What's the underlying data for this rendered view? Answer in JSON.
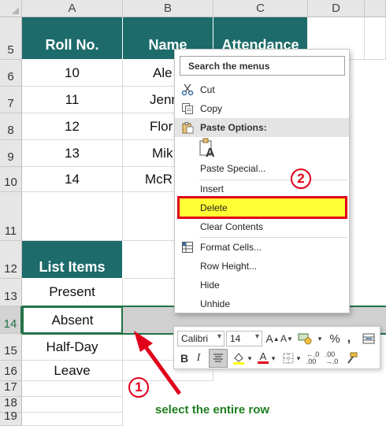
{
  "columns": [
    "A",
    "B",
    "C",
    "D"
  ],
  "rows": [
    "5",
    "6",
    "7",
    "8",
    "9",
    "10",
    "11",
    "12",
    "13",
    "14",
    "15",
    "16",
    "17",
    "18",
    "19"
  ],
  "table": {
    "headers": [
      "Roll No.",
      "Name",
      "Attendance"
    ],
    "roll_numbers": [
      "10",
      "11",
      "12",
      "13",
      "14"
    ],
    "names_visible": [
      "Ale",
      "Jenn",
      "Flor",
      "Mik",
      "McR"
    ]
  },
  "list": {
    "header": "List Items",
    "items": [
      "Present",
      "Absent",
      "Half-Day",
      "Leave"
    ]
  },
  "context_menu": {
    "search_placeholder": "Search the menus",
    "items": {
      "cut": "Cut",
      "copy": "Copy",
      "paste_options": "Paste Options:",
      "paste_special": "Paste Special...",
      "insert": "Insert",
      "delete": "Delete",
      "clear_contents": "Clear Contents",
      "format_cells": "Format Cells...",
      "row_height": "Row Height...",
      "hide": "Hide",
      "unhide": "Unhide"
    }
  },
  "mini_toolbar": {
    "font_name": "Calibri",
    "font_size": "14"
  },
  "annotations": {
    "step1": "1",
    "step2": "2",
    "caption": "select the entire row"
  },
  "colors": {
    "header_fill": "#1d6b6b",
    "highlight_fill": "#ffff33",
    "annotation_red": "#e0001b",
    "caption_green": "#1e7d1e",
    "selection_green": "#217346"
  }
}
